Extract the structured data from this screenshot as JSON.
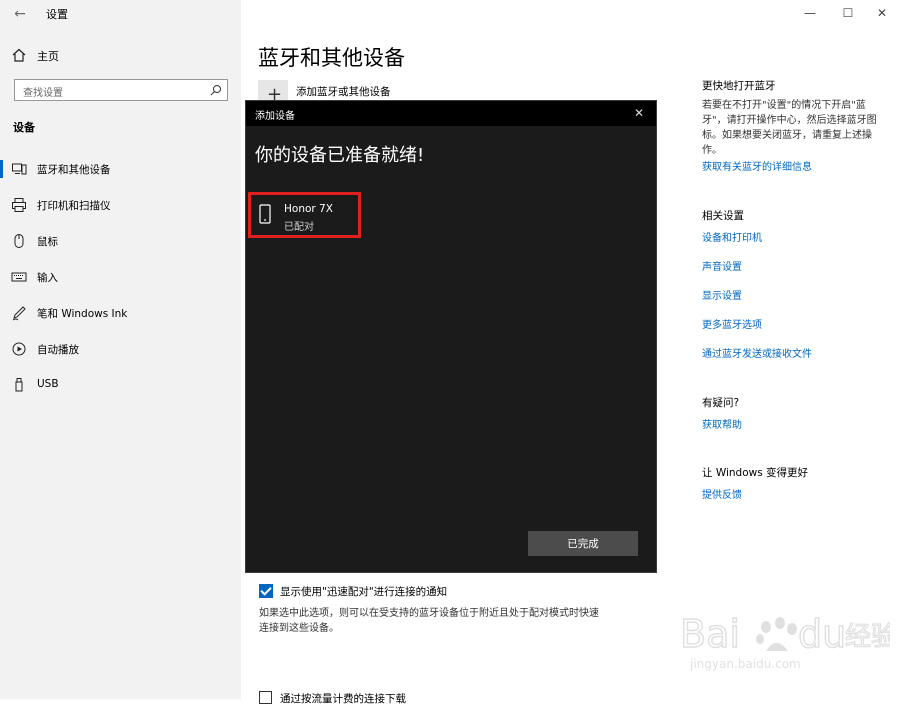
{
  "window": {
    "title": "设置",
    "minimize_glyph": "—",
    "maximize_glyph": "☐",
    "close_glyph": "✕"
  },
  "sidebar": {
    "home_label": "主页",
    "search_placeholder": "查找设置",
    "section_title": "设备",
    "items": [
      {
        "label": "蓝牙和其他设备",
        "icon": "bluetooth-devices-icon",
        "active": true
      },
      {
        "label": "打印机和扫描仪",
        "icon": "printer-icon"
      },
      {
        "label": "鼠标",
        "icon": "mouse-icon"
      },
      {
        "label": "输入",
        "icon": "keyboard-icon"
      },
      {
        "label": "笔和 Windows Ink",
        "icon": "pen-icon"
      },
      {
        "label": "自动播放",
        "icon": "autoplay-icon"
      },
      {
        "label": "USB",
        "icon": "usb-icon"
      }
    ]
  },
  "main": {
    "title": "蓝牙和其他设备",
    "add_device_label": "添加蓝牙或其他设备",
    "swift_pair_label": "显示使用\"迅速配对\"进行连接的通知",
    "swift_pair_checked": true,
    "swift_pair_desc": "如果选中此选项，则可以在受支持的蓝牙设备位于附近且处于配对模式时快速连接到这些设备。",
    "metered_label": "通过按流量计费的连接下载"
  },
  "right": {
    "quick_title": "更快地打开蓝牙",
    "quick_desc": "若要在不打开\"设置\"的情况下开启\"蓝牙\"，请打开操作中心，然后选择蓝牙图标。如果想要关闭蓝牙，请重复上述操作。",
    "more_info_link": "获取有关蓝牙的详细信息",
    "related_title": "相关设置",
    "related_links": [
      "设备和打印机",
      "声音设置",
      "显示设置",
      "更多蓝牙选项",
      "通过蓝牙发送或接收文件"
    ],
    "question_title": "有疑问?",
    "help_link": "获取帮助",
    "better_title": "让 Windows 变得更好",
    "feedback_link": "提供反馈"
  },
  "dialog": {
    "title": "添加设备",
    "close_glyph": "✕",
    "heading": "你的设备已准备就绪!",
    "device_name": "Honor 7X",
    "device_status": "已配对",
    "done_label": "已完成"
  },
  "watermark": {
    "text": "jingyan.baidu.com"
  }
}
